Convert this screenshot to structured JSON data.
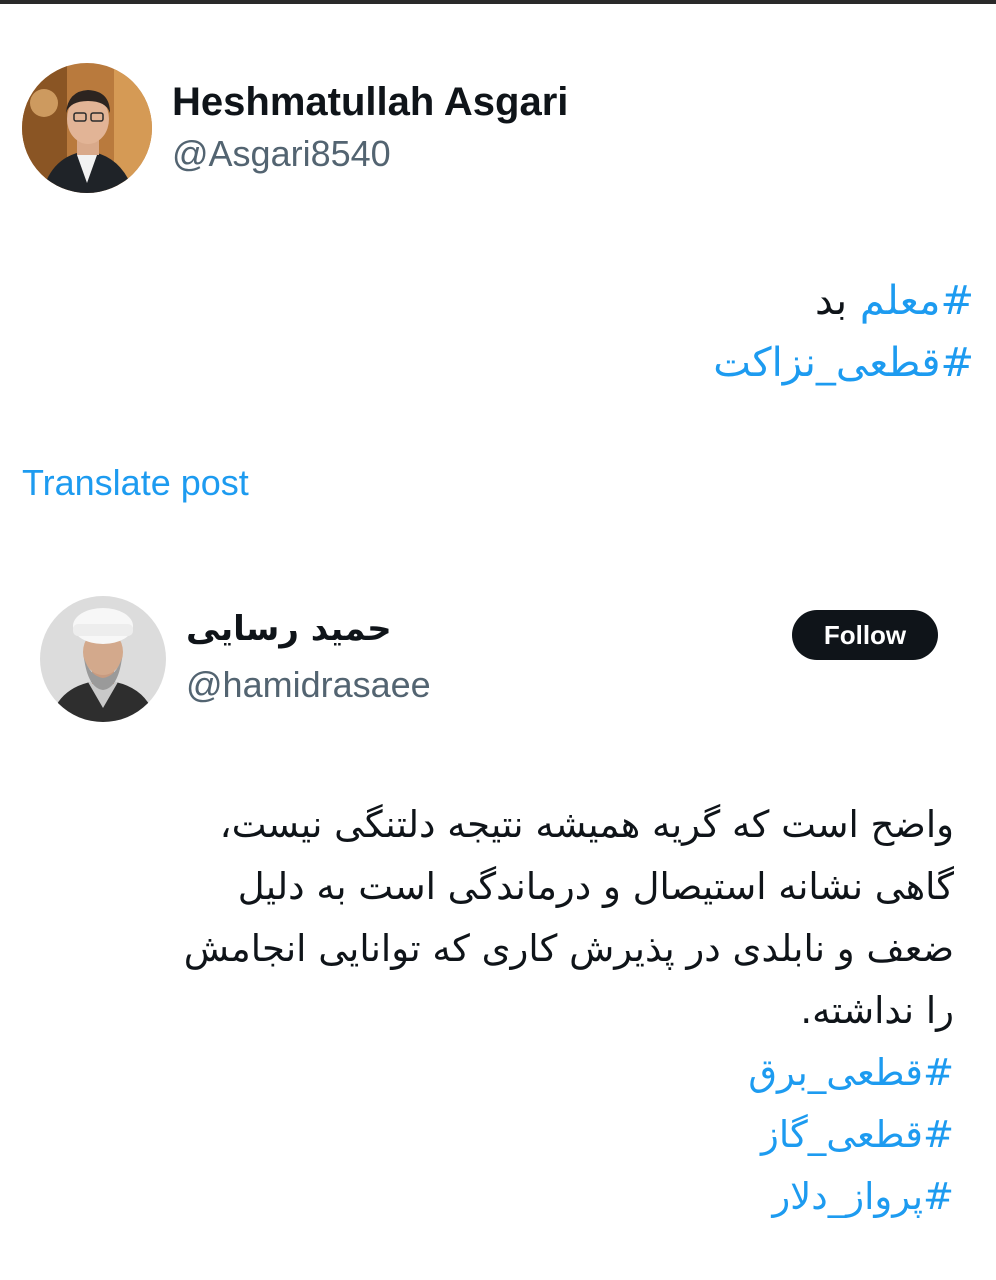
{
  "main_post": {
    "author_name": "Heshmatullah Asgari",
    "author_handle": "@Asgari8540",
    "text_line1_hashtag": "#معلم",
    "text_line1_word": "بد",
    "text_line2_hashtag": "#قطعی_نزاکت",
    "translate_label": "Translate post"
  },
  "quoted_post": {
    "author_name": "حمید رسایی",
    "author_handle": "@hamidrasaee",
    "follow_label": "Follow",
    "body": "واضح است که گریه همیشه نتیجه دلتنگی نیست،\nگاهی نشانه استیصال و درماندگی است به دلیل\nضعف و نابلدی در پذیرش کاری که توانایی انجامش\nرا نداشته.",
    "hashtags": [
      "#قطعی_برق",
      "#قطعی_گاز",
      "#پرواز_دلار"
    ]
  },
  "colors": {
    "link": "#1d9bf0",
    "text": "#0f1419",
    "muted": "#536471",
    "button_bg": "#0f1419"
  },
  "icons": {
    "main_avatar": "avatar-photo",
    "quote_avatar": "avatar-photo"
  }
}
